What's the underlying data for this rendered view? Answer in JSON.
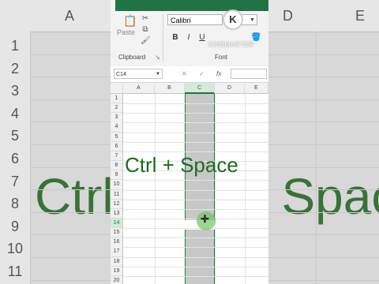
{
  "overlay_text": "Ctrl + Space",
  "ribbon": {
    "paste_label": "Paste",
    "clipboard_label": "Clipboard",
    "font_group_label": "Font",
    "font_name": "Calibri",
    "bold": "B",
    "italic": "I",
    "underline": "U",
    "launcher": "↘"
  },
  "watermark": {
    "letter": "K",
    "text": "KINEMASTER"
  },
  "formula_bar": {
    "name_box": "C14",
    "cancel": "✕",
    "enter": "✓",
    "fx": "fx"
  },
  "columns": [
    "A",
    "B",
    "C",
    "D",
    "E"
  ],
  "selected_column": "C",
  "rows": [
    "1",
    "2",
    "3",
    "4",
    "5",
    "6",
    "7",
    "8",
    "9",
    "10",
    "11",
    "12",
    "13",
    "14",
    "15",
    "16",
    "17",
    "18",
    "19",
    "20"
  ],
  "background": {
    "left_col": "A",
    "right_cols": [
      "D",
      "E"
    ],
    "left_rows": [
      "1",
      "2",
      "3",
      "4",
      "5",
      "6",
      "7",
      "8",
      "9",
      "10",
      "11"
    ],
    "right_rows": [
      "",
      "",
      "",
      "",
      "",
      "",
      "",
      "",
      "",
      "",
      ""
    ]
  },
  "colors": {
    "excel_green": "#217346",
    "overlay_green": "#1f6b1f",
    "selection_gray": "#c8c8c8"
  }
}
